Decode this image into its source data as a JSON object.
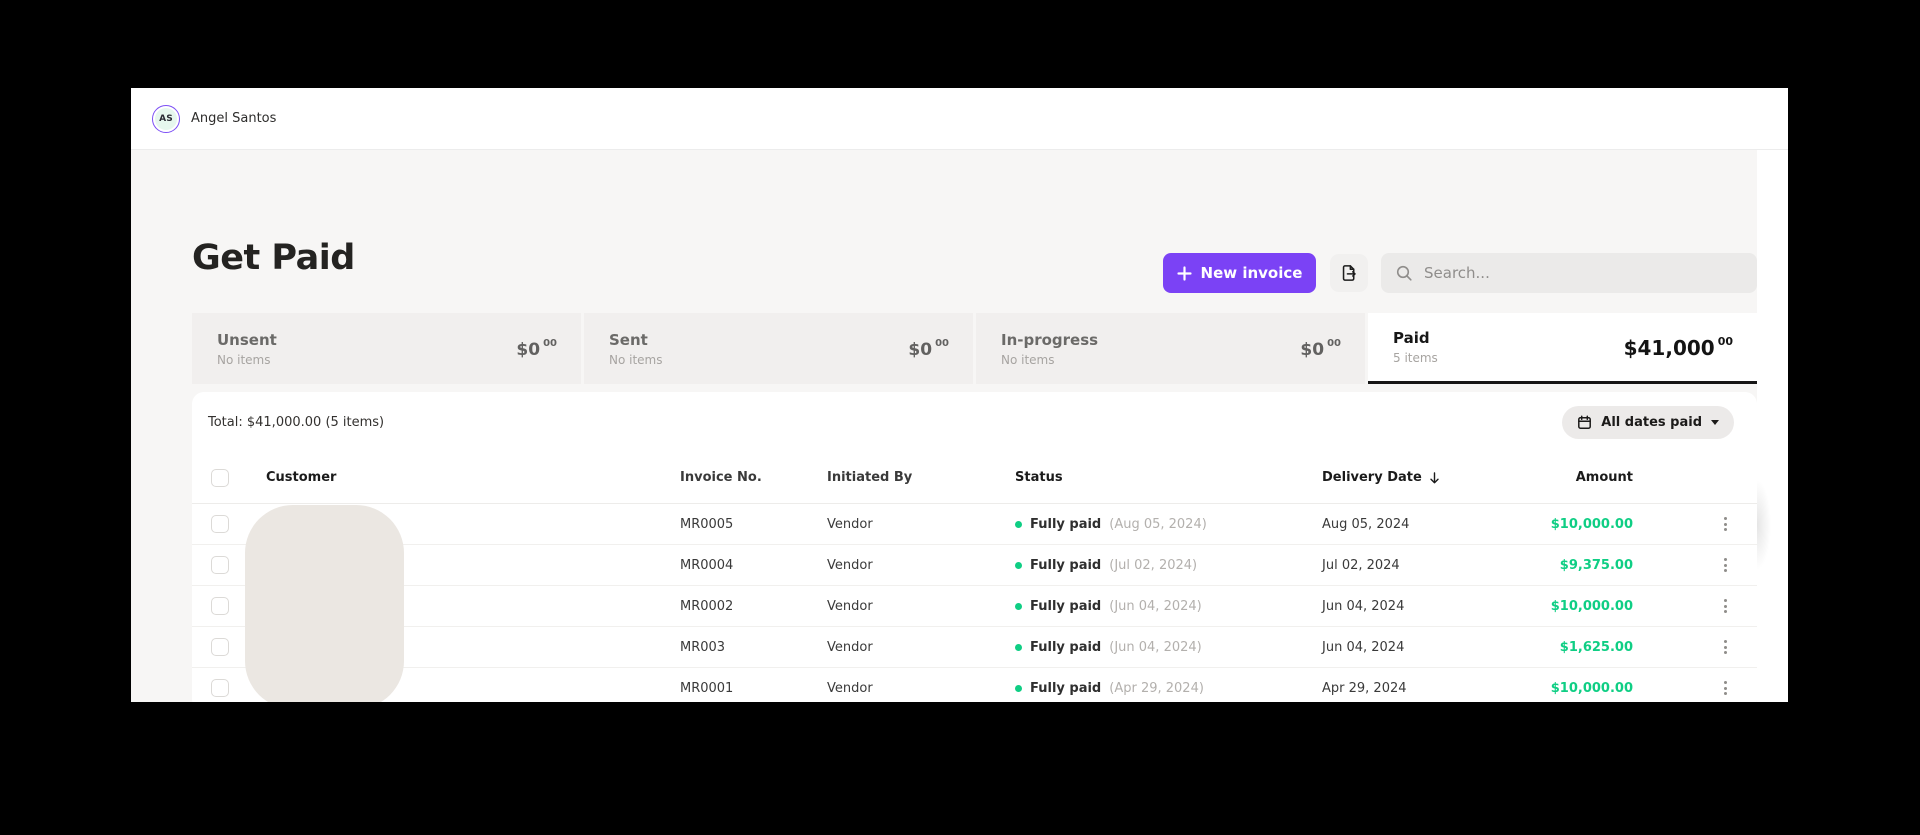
{
  "topbar": {
    "user_initials": "AS",
    "user_name": "Angel Santos"
  },
  "page": {
    "title": "Get Paid"
  },
  "toolbar": {
    "new_invoice_label": "New invoice",
    "search_placeholder": "Search..."
  },
  "tabs": [
    {
      "label": "Unsent",
      "items": "No items",
      "amount": "$0",
      "cents": "00"
    },
    {
      "label": "Sent",
      "items": "No items",
      "amount": "$0",
      "cents": "00"
    },
    {
      "label": "In-progress",
      "items": "No items",
      "amount": "$0",
      "cents": "00"
    },
    {
      "label": "Paid",
      "items": "5 items",
      "amount": "$41,000",
      "cents": "00"
    }
  ],
  "filters": {
    "total_summary": "Total: $41,000.00 (5 items)",
    "date_filter_label": "All dates paid"
  },
  "table": {
    "headers": {
      "customer": "Customer",
      "invoice_no": "Invoice No.",
      "initiated_by": "Initiated By",
      "status": "Status",
      "delivery_date": "Delivery Date",
      "amount": "Amount"
    },
    "sort": {
      "column": "Delivery Date",
      "direction": "desc"
    },
    "rows": [
      {
        "invoice_no": "MR0005",
        "initiated_by": "Vendor",
        "status": "Fully paid",
        "status_date": "(Aug 05, 2024)",
        "delivery_date": "Aug 05, 2024",
        "amount": "$10,000.00"
      },
      {
        "invoice_no": "MR0004",
        "initiated_by": "Vendor",
        "status": "Fully paid",
        "status_date": "(Jul 02, 2024)",
        "delivery_date": "Jul 02, 2024",
        "amount": "$9,375.00"
      },
      {
        "invoice_no": "MR0002",
        "initiated_by": "Vendor",
        "status": "Fully paid",
        "status_date": "(Jun 04, 2024)",
        "delivery_date": "Jun 04, 2024",
        "amount": "$10,000.00"
      },
      {
        "invoice_no": "MR003",
        "initiated_by": "Vendor",
        "status": "Fully paid",
        "status_date": "(Jun 04, 2024)",
        "delivery_date": "Jun 04, 2024",
        "amount": "$1,625.00"
      },
      {
        "invoice_no": "MR0001",
        "initiated_by": "Vendor",
        "status": "Fully paid",
        "status_date": "(Apr 29, 2024)",
        "delivery_date": "Apr 29, 2024",
        "amount": "$10,000.00"
      }
    ]
  },
  "colors": {
    "accent_purple": "#7b42f5",
    "positive_green": "#0fce84",
    "page_bg": "#000000",
    "window_bg": "#ffffff",
    "main_bg": "#f7f6f5",
    "tab_inactive_bg": "#f1efee",
    "redaction_blob": "#ebe7e2"
  }
}
